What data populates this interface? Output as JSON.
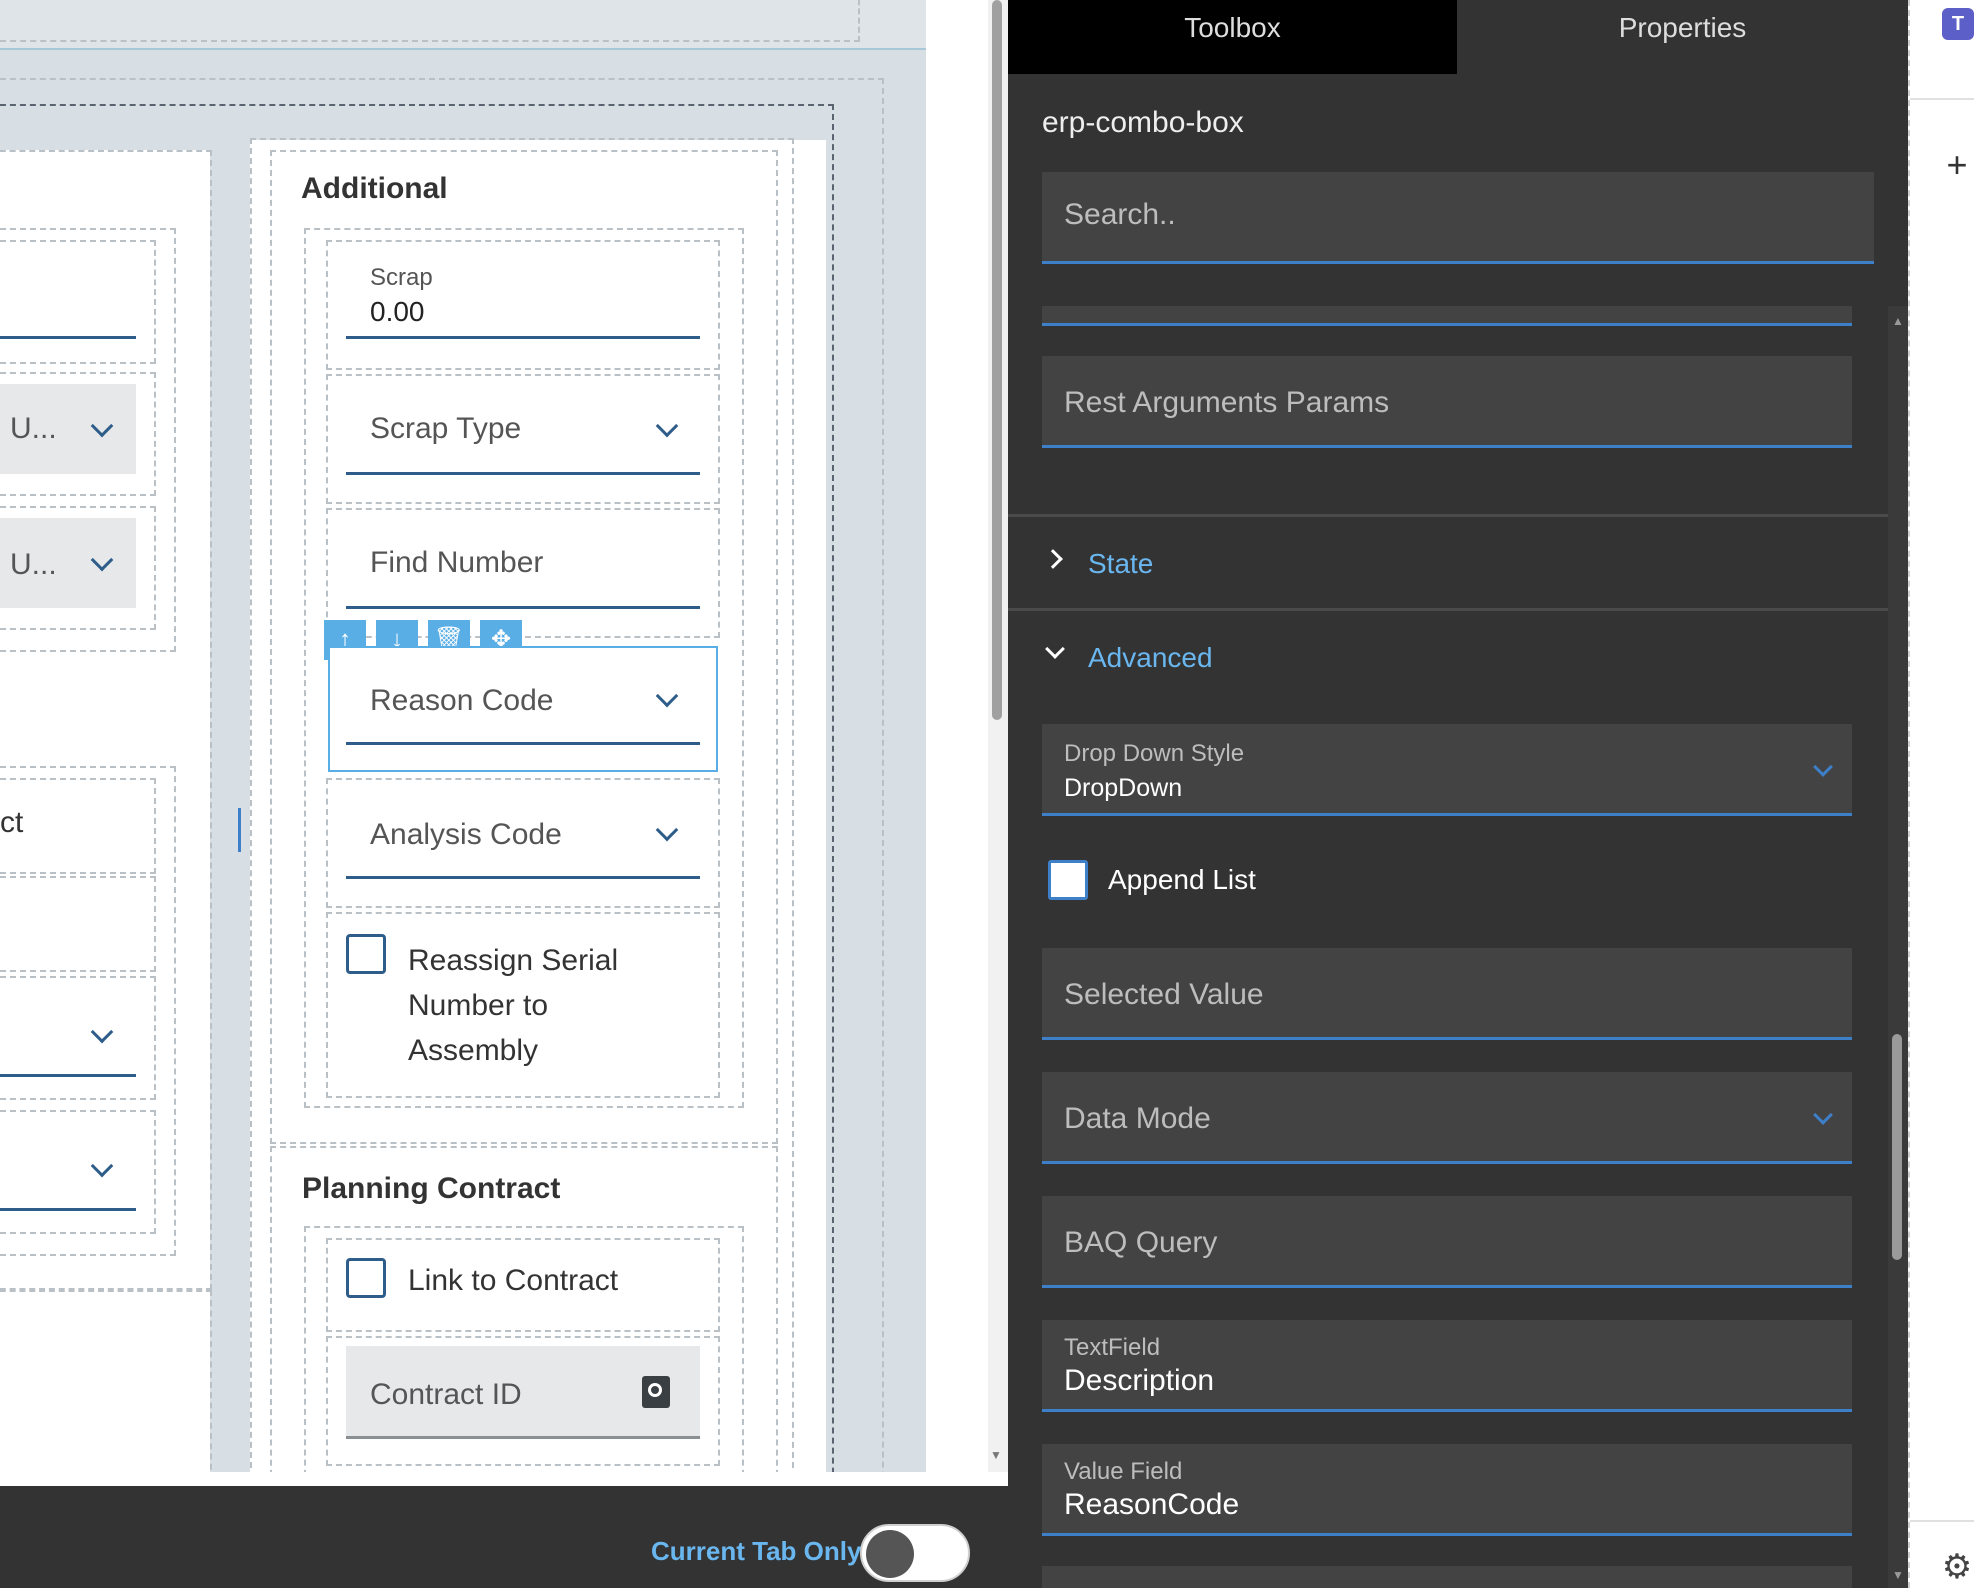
{
  "canvas": {
    "left_fields": {
      "combo1_value": "U...",
      "combo2_value": "U...",
      "partial_text": "ct"
    },
    "additional": {
      "title": "Additional",
      "scrap_label": "Scrap",
      "scrap_value": "0.00",
      "scrap_type": "Scrap Type",
      "find_number": "Find Number",
      "reason_code": "Reason Code",
      "analysis_code": "Analysis Code",
      "reassign_label": "Reassign Serial Number to Assembly"
    },
    "planning": {
      "title": "Planning Contract",
      "link_label": "Link to Contract",
      "contract_id": "Contract ID"
    },
    "toolbar_icons": [
      "arrow-up-icon",
      "arrow-down-icon",
      "trash-icon",
      "move-icon"
    ],
    "footer": {
      "current_tab_label": "Current Tab Only",
      "toggle_on": false
    }
  },
  "panel": {
    "tabs": [
      {
        "label": "Toolbox",
        "active": false
      },
      {
        "label": "Properties",
        "active": true
      }
    ],
    "component_name": "erp-combo-box",
    "search_placeholder": "Search..",
    "rest_args": "Rest Arguments Params",
    "sections": {
      "state": "State",
      "advanced": "Advanced"
    },
    "dropdown_style": {
      "label": "Drop Down Style",
      "value": "DropDown"
    },
    "append_list": {
      "label": "Append List",
      "checked": false
    },
    "selected_value": "Selected Value",
    "data_mode": "Data Mode",
    "baq_query": "BAQ Query",
    "text_field": {
      "label": "TextField",
      "value": "Description"
    },
    "value_field": {
      "label": "Value Field",
      "value": "ReasonCode"
    }
  },
  "colors": {
    "accent": "#3d7fc9",
    "link": "#6ab7f0",
    "panel_bg": "#333333",
    "field_bg": "#434343",
    "canvas_bg": "#d7dee4",
    "selection": "#5aaee6"
  }
}
